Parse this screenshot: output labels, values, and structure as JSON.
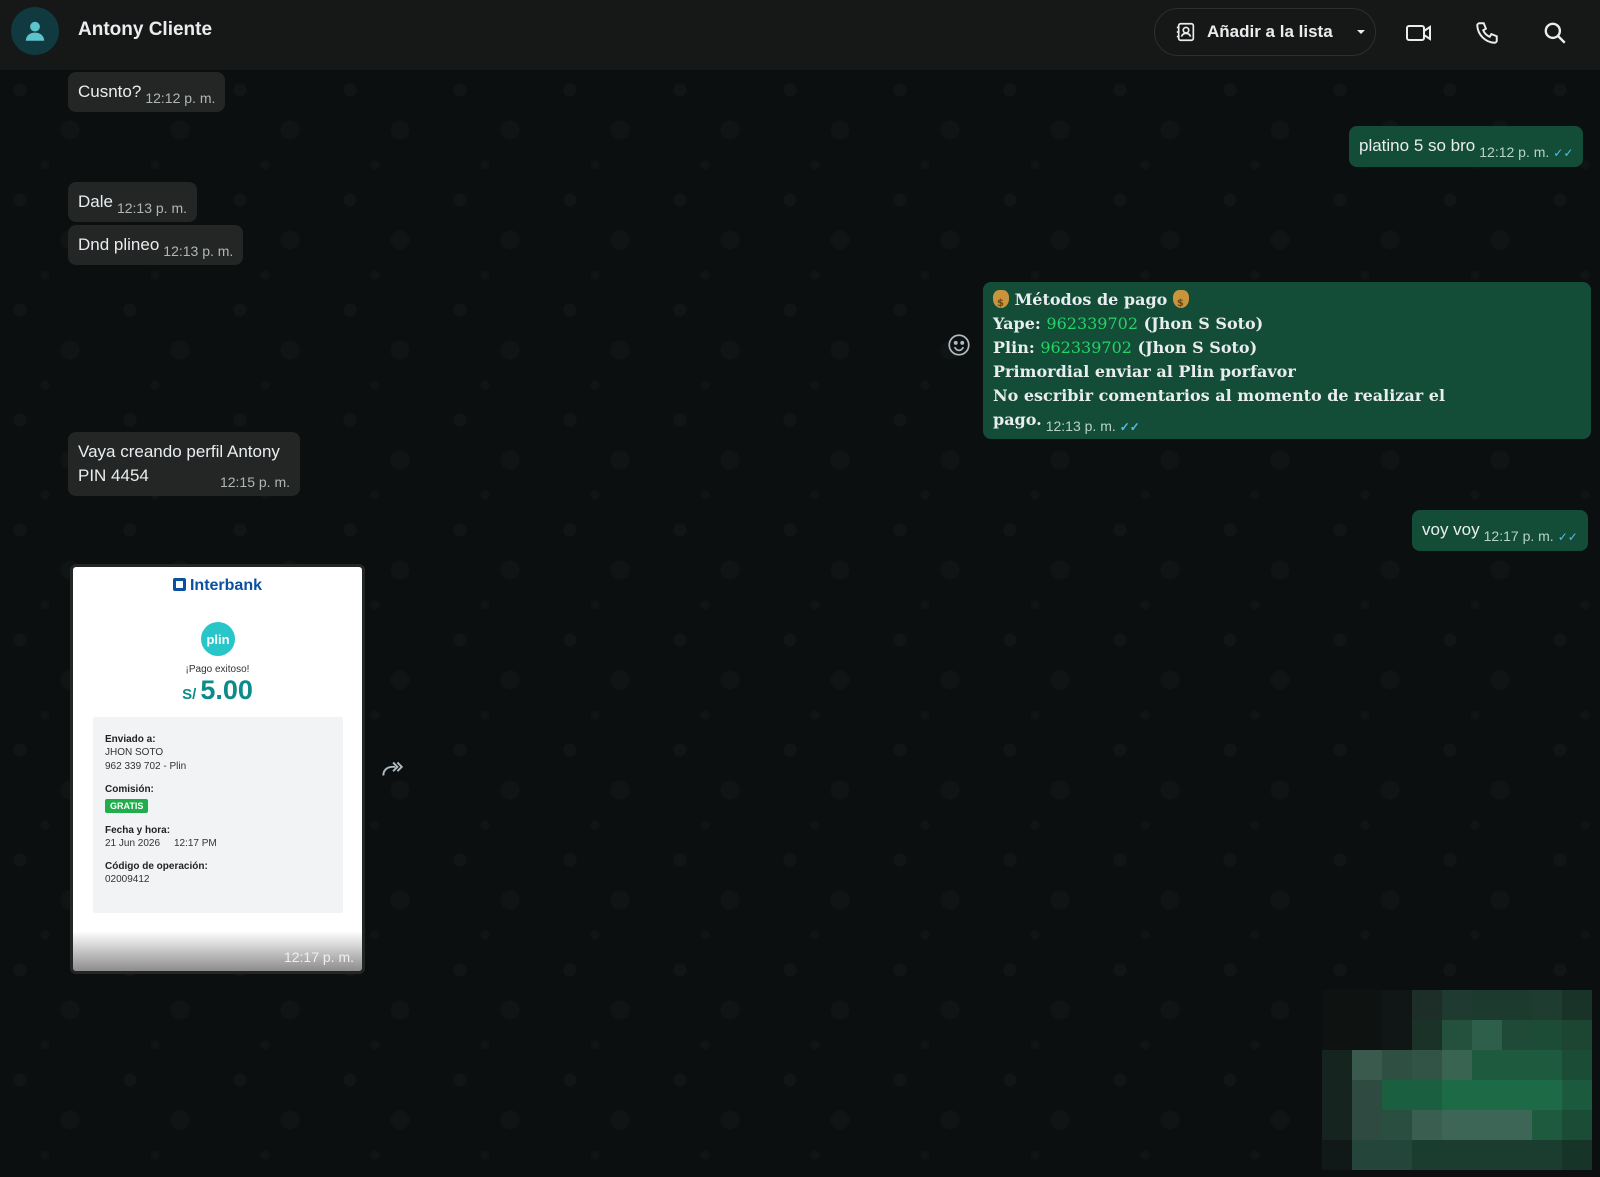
{
  "header": {
    "contact_name": "Antony Cliente",
    "add_to_list_label": "Añadir a la lista"
  },
  "messages": {
    "m1": {
      "text": "Cusnto?",
      "time": "12:12 p. m."
    },
    "m2": {
      "text": "platino 5 so bro",
      "time": "12:12 p. m."
    },
    "m3": {
      "text": "Dale",
      "time": "12:13 p. m."
    },
    "m4": {
      "text": "Dnd plineo",
      "time": "12:13 p. m."
    },
    "m5": {
      "title": "Métodos de pago",
      "yape_label": "Yape:",
      "yape_number": "962339702",
      "yape_name": "(Jhon S Soto)",
      "plin_label": "Plin:",
      "plin_number": "962339702",
      "plin_name": "(Jhon S Soto)",
      "line4": "Primordial enviar al Plin porfavor",
      "line5": "No escribir comentarios al momento de realizar el pago.",
      "time": "12:13 p. m."
    },
    "m6": {
      "line1": "Vaya creando perfil Antony",
      "line2": "PIN 4454",
      "time": "12:15 p. m."
    },
    "m7": {
      "text": "voy voy",
      "time": "12:17 p. m."
    },
    "m8": {
      "time": "12:17 p. m.",
      "receipt": {
        "brand": "Interbank",
        "plin": "plin",
        "success": "¡Pago exitoso!",
        "currency": "S/",
        "amount": "5.00",
        "sent_to_label": "Enviado a:",
        "sent_to_name": "JHON SOTO",
        "sent_to_number": "962 339 702 - Plin",
        "commission_label": "Comisión:",
        "commission_value": "GRATIS",
        "datetime_label": "Fecha y hora:",
        "datetime_value": "21 Jun 2026     12:17 PM",
        "opcode_label": "Código de operación:",
        "opcode_value": "02009412"
      }
    }
  },
  "colors": {
    "header_bg": "#161717",
    "incoming_bubble": "#242626",
    "outgoing_bubble": "#144d37",
    "read_ticks": "#53bdeb",
    "link_green": "#25d366"
  },
  "icons": {
    "avatar": "person-icon",
    "add_list": "contact-list-icon",
    "dropdown": "caret-down-icon",
    "video": "video-camera-icon",
    "call": "phone-icon",
    "search": "search-icon",
    "react": "emoji-icon",
    "forward": "forward-icon"
  }
}
